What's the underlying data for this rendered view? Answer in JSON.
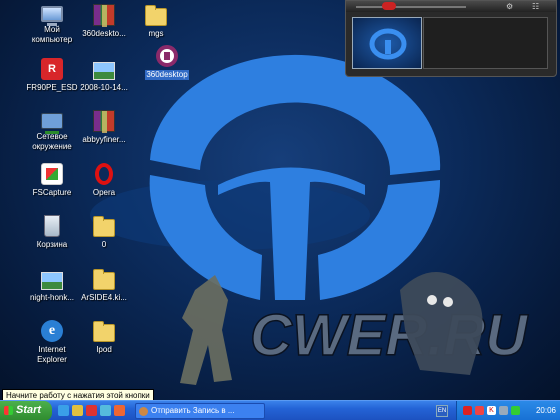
{
  "desktop_icons": {
    "my_computer": "Мой компьютер",
    "desktop_archive_1": "360deskto...",
    "mgs": "mgs",
    "desktop_360": "360desktop",
    "fr90pe": "FR90PE_ESD",
    "image_2008": "2008-10-14...",
    "network": "Сетевое окружение",
    "abbyy": "abbyyfiner...",
    "fscapture": "FSCapture",
    "opera": "Opera",
    "recycle_bin": "Корзина",
    "folder_0": "0",
    "night_honk": "night-honk...",
    "arside": "ArSIDE4.ki...",
    "ie": "Internet Explorer",
    "ipod": "Ipod"
  },
  "wallpaper": {
    "brand_text": "CWER.RU"
  },
  "preview_panel": {
    "gear": "⚙",
    "menu": "☷"
  },
  "taskbar": {
    "start_label": "Start",
    "task_item_label": "Отправить Запись в ...",
    "language": "EN",
    "clock": "20:06"
  },
  "tooltip": {
    "text": "Начните работу с нажатия этой кнопки"
  },
  "colors": {
    "desktop_bg": "#0b2a5a",
    "logo_blue": "#2e7fe0",
    "taskbar": "#2463d6",
    "start_green": "#2e8a2e"
  }
}
